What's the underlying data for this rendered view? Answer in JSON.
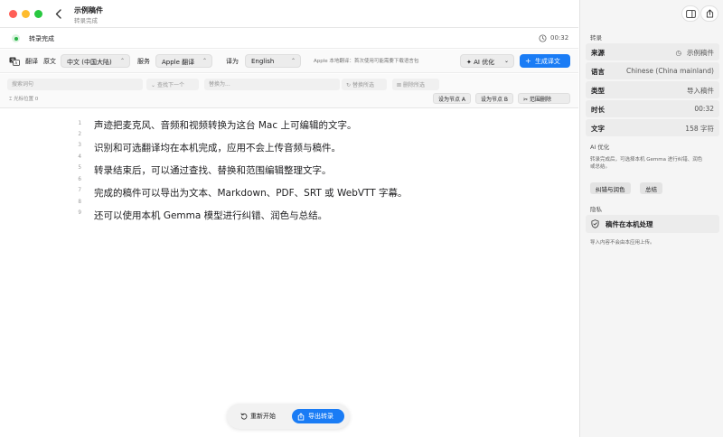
{
  "window": {
    "title": "示例稿件",
    "subtitle": "转录完成"
  },
  "status": {
    "text": "转录完成",
    "time": "00:32",
    "colors": {
      "ok": "#28b446"
    }
  },
  "translate": {
    "label": "翻译",
    "source_label": "原文",
    "source_value": "中文 (中国大陆)",
    "service_label": "服务",
    "service_value": "Apple 翻译",
    "target_label": "译为",
    "target_value": "English",
    "note": "Apple 本地翻译：首次使用可能需要下载语言包",
    "ai_button": "AI 优化",
    "generate_button": "生成译文",
    "accent": "#1a7cf5"
  },
  "search": {
    "search_placeholder": "搜索词句",
    "find_next": "查找下一个",
    "replace_placeholder": "替换为...",
    "replace_selected": "替换所选",
    "delete_selected": "删除所选",
    "cursor_info": "光标位置 0",
    "set_node_a": "设为节点 A",
    "set_node_b": "设为节点 B",
    "range_delete": "范围删除"
  },
  "editor": {
    "line_numbers": [
      "1",
      "2",
      "3",
      "4",
      "5",
      "6",
      "7",
      "8",
      "9"
    ],
    "lines": [
      "声迹把麦克风、音频和视频转换为这台 Mac 上可编辑的文字。",
      "识别和可选翻译均在本机完成，应用不会上传音频与稿件。",
      "转录结束后，可以通过查找、替换和范围编辑整理文字。",
      "完成的稿件可以导出为文本、Markdown、PDF、SRT 或 WebVTT 字幕。",
      "还可以使用本机 Gemma 模型进行纠错、润色与总结。"
    ]
  },
  "bottom_bar": {
    "restart": "重新开始",
    "export": "导出转录"
  },
  "sidebar": {
    "section_transcription": "转录",
    "rows": [
      {
        "key": "来源",
        "value": "示例稿件"
      },
      {
        "key": "语言",
        "value": "Chinese (China mainland)"
      },
      {
        "key": "类型",
        "value": "导入稿件"
      },
      {
        "key": "时长",
        "value": "00:32"
      },
      {
        "key": "文字",
        "value": "158 字符"
      }
    ],
    "section_ai": "AI 优化",
    "ai_desc_1": "转录完成后，可选择本机 Gemma 进行纠错、润色",
    "ai_desc_2": "或总结。",
    "chip_fix": "纠错与润色",
    "chip_summary": "总结",
    "section_privacy": "隐私",
    "privacy_title": "稿件在本机处理",
    "privacy_desc": "导入内容不会由本应用上传。"
  }
}
